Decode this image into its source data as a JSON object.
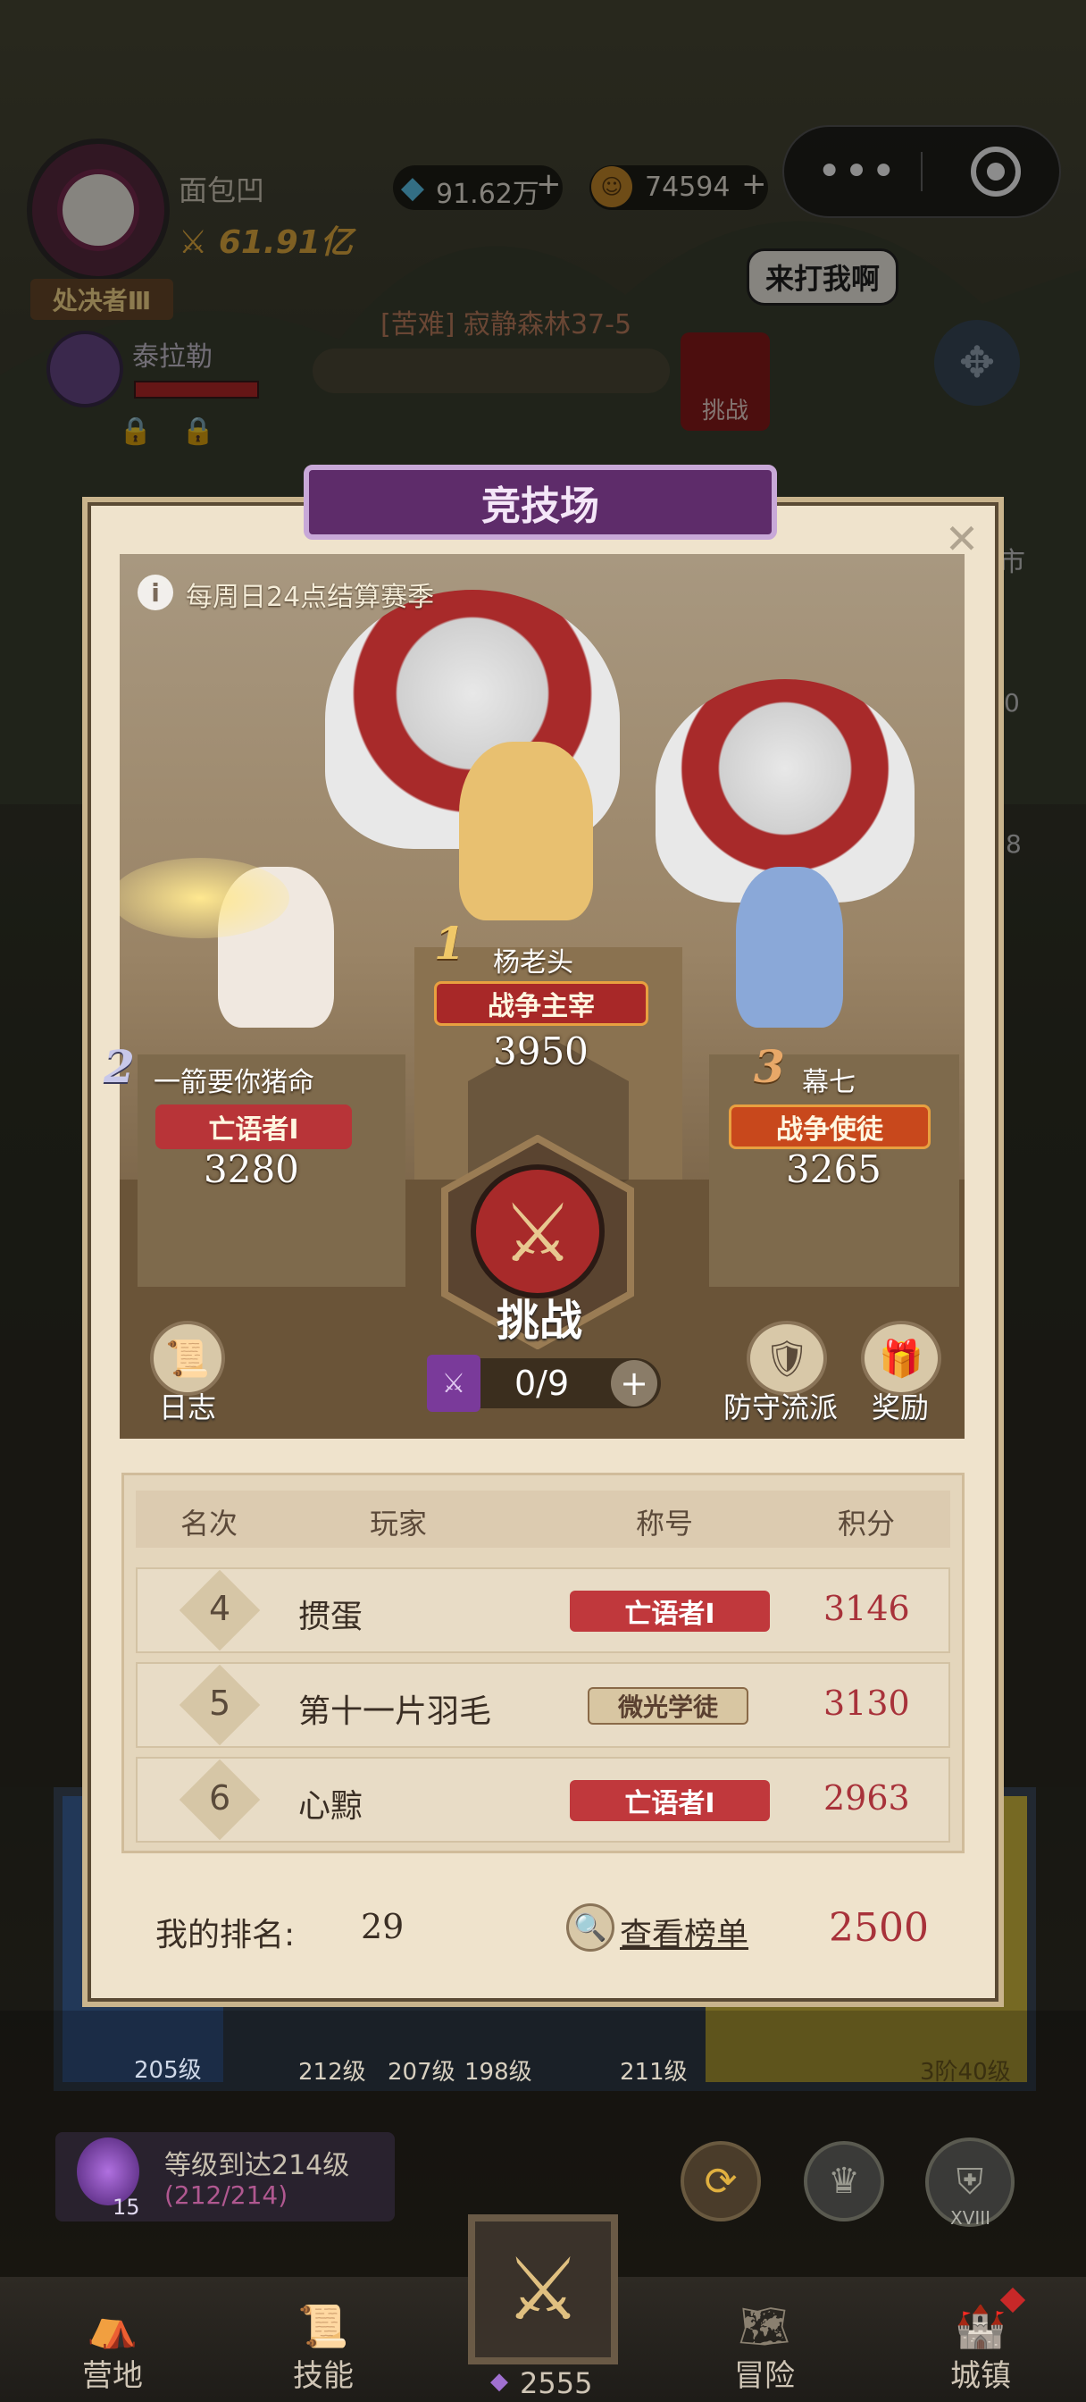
{
  "top": {
    "player_name": "面包凹",
    "power": "61.91亿",
    "rank_badge": "处决者Ⅲ",
    "diamonds": "91.62万",
    "coins": "74594",
    "companion_name": "泰拉勒",
    "stage_title": "[苦难] 寂静森林37-5",
    "boss_speech": "来打我啊",
    "boss_button": "挑战"
  },
  "background_side_labels": {
    "right_label_1": "市",
    "right_label_2": "0",
    "right_label_3": "8"
  },
  "arena": {
    "title": "竞技场",
    "notice": "每周日24点结算赛季",
    "podium": [
      {
        "rank": "1",
        "name": "杨老头",
        "title": "战争主宰",
        "score": "3950"
      },
      {
        "rank": "2",
        "name": "一箭要你猪命",
        "title": "亡语者Ⅰ",
        "score": "3280"
      },
      {
        "rank": "3",
        "name": "幕七",
        "title": "战争使徒",
        "score": "3265"
      }
    ],
    "challenge_label": "挑战",
    "tickets": "0/9",
    "log_label": "日志",
    "defense_label": "防守流派",
    "reward_label": "奖励",
    "table_headers": {
      "rank": "名次",
      "player": "玩家",
      "title": "称号",
      "score": "积分"
    },
    "rows": [
      {
        "rank": "4",
        "player": "掼蛋",
        "title": "亡语者Ⅰ",
        "score": "3146"
      },
      {
        "rank": "5",
        "player": "第十一片羽毛",
        "title": "微光学徒",
        "score": "3130"
      },
      {
        "rank": "6",
        "player": "心黥",
        "title": "亡语者Ⅰ",
        "score": "2963"
      }
    ],
    "my_rank_label": "我的排名:",
    "my_rank": "29",
    "view_board": "查看榜单",
    "my_score": "2500"
  },
  "lower_bg": {
    "levels": [
      "205级",
      "212级",
      "207级",
      "198级",
      "211级",
      "3阶40级"
    ],
    "quest_text": "等级到达214级",
    "quest_progress": "(212/214)",
    "quest_count": "15",
    "badge_roman": "XVIII"
  },
  "nav": {
    "camp": "营地",
    "skills": "技能",
    "center_value": "2555",
    "adventure": "冒险",
    "town": "城镇"
  },
  "colors": {
    "accent_red": "#b8343a",
    "score_red": "#a8323a",
    "purple_banner": "#5e2c6a",
    "gold": "#e8c060"
  }
}
